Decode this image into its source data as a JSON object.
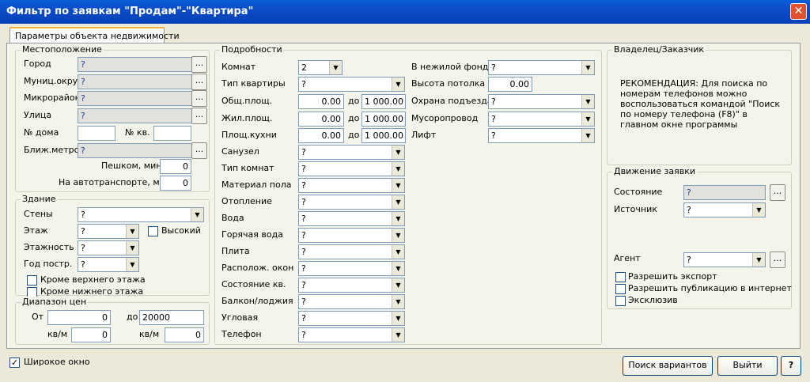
{
  "window": {
    "title": "Фильтр по заявкам \"Продам\"-\"Квартира\""
  },
  "tab": {
    "label": "Параметры объекта недвижимости"
  },
  "location": {
    "title": "Местоположение",
    "city": "Город",
    "municipal": "Муниц.округ",
    "microdistrict": "Микрорайон",
    "street": "Улица",
    "house_no": "№ дома",
    "flat_no": "№ кв.",
    "metro": "Ближ.метро",
    "walk_label": "Пешком, мин",
    "walk_value": "0",
    "transport_label": "На автотранспорте, мин",
    "transport_value": "0",
    "q": "?"
  },
  "building": {
    "title": "Здание",
    "walls": "Стены",
    "floor": "Этаж",
    "high": "Высокий",
    "floors": "Этажность",
    "year": "Год постр.",
    "except_top": "Кроме верхнего этажа",
    "except_bottom": "Кроме нижнего этажа",
    "q": "?"
  },
  "prices": {
    "title": "Диапазон цен",
    "from": "От",
    "from_value": "0",
    "to": "до",
    "to_value": "20000",
    "sqm": "кв/м",
    "sqm_from": "0",
    "sqm_to": "0"
  },
  "details": {
    "title": "Подробности",
    "rooms": "Комнат",
    "rooms_value": "2",
    "flat_type": "Тип квартиры",
    "total_area": "Общ.площ.",
    "living_area": "Жил.площ.",
    "kitchen_area": "Площ.кухни",
    "to": "до",
    "zero": "0.00",
    "max": "1 000.00",
    "bathroom": "Санузел",
    "room_type": "Тип комнат",
    "floor_material": "Материал пола",
    "heating": "Отопление",
    "water": "Вода",
    "hot_water": "Горячая вода",
    "stove": "Плита",
    "windows": "Располож. окон",
    "condition": "Состояние кв.",
    "balcony": "Балкон/лоджия",
    "corner": "Угловая",
    "phone": "Телефон",
    "non_residential": "В нежилой фонд",
    "ceiling": "Высота потолка",
    "ceiling_value": "0.00",
    "security": "Охрана подъезда",
    "garbage": "Мусоропровод",
    "lift": "Лифт",
    "q": "?"
  },
  "owner": {
    "title": "Владелец/Заказчик",
    "note": "РЕКОМЕНДАЦИЯ: Для поиска по номерам телефонов можно воспользоваться командой \"Поиск по номеру телефона (F8)\" в главном окне программы"
  },
  "movement": {
    "title": "Движение заявки",
    "state": "Состояние",
    "source": "Источник",
    "agent": "Агент",
    "export": "Разрешить экспорт",
    "publish": "Разрешить публикацию в интернет",
    "exclusive": "Эксклюзив",
    "q": "?"
  },
  "footer": {
    "wide_window": "Широкое окно",
    "search_button": "Поиск вариантов",
    "exit_button": "Выйти",
    "help_button": "?"
  },
  "common": {
    "ellipsis": "...",
    "close": "✕",
    "check": "✓",
    "arrow": "▼"
  }
}
